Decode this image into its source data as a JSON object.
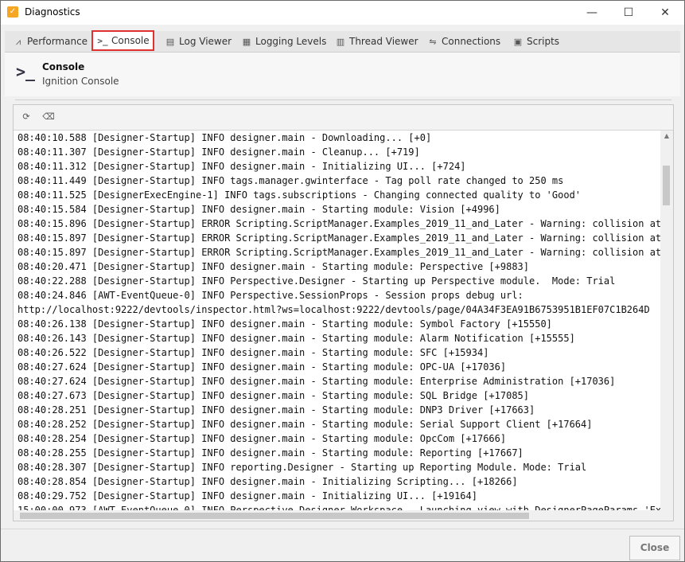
{
  "window": {
    "title": "Diagnostics"
  },
  "tabs": [
    {
      "label": "Performance",
      "icon": "pulse-icon"
    },
    {
      "label": "Console",
      "icon": "terminal-icon",
      "active": true
    },
    {
      "label": "Log Viewer",
      "icon": "document-icon"
    },
    {
      "label": "Logging Levels",
      "icon": "table-icon"
    },
    {
      "label": "Thread Viewer",
      "icon": "thread-icon"
    },
    {
      "label": "Connections",
      "icon": "connection-icon"
    },
    {
      "label": "Scripts",
      "icon": "script-icon"
    }
  ],
  "header": {
    "title": "Console",
    "subtitle": "Ignition Console"
  },
  "colors": {
    "active_tab_outline": "#e03030"
  },
  "log_lines": [
    "08:40:10.588 [Designer-Startup] INFO designer.main - Downloading... [+0]",
    "08:40:11.307 [Designer-Startup] INFO designer.main - Cleanup... [+719]",
    "08:40:11.312 [Designer-Startup] INFO designer.main - Initializing UI... [+724]",
    "08:40:11.449 [Designer-Startup] INFO tags.manager.gwinterface - Tag poll rate changed to 250 ms",
    "08:40:11.525 [DesignerExecEngine-1] INFO tags.subscriptions - Changing connected quality to 'Good'",
    "08:40:15.584 [Designer-Startup] INFO designer.main - Starting module: Vision [+4996]",
    "08:40:15.896 [Designer-Startup] ERROR Scripting.ScriptManager.Examples_2019_11_and_Later - Warning: collision at sys",
    "08:40:15.897 [Designer-Startup] ERROR Scripting.ScriptManager.Examples_2019_11_and_Later - Warning: collision at sys",
    "08:40:15.897 [Designer-Startup] ERROR Scripting.ScriptManager.Examples_2019_11_and_Later - Warning: collision at sys",
    "08:40:20.471 [Designer-Startup] INFO designer.main - Starting module: Perspective [+9883]",
    "08:40:22.288 [Designer-Startup] INFO Perspective.Designer - Starting up Perspective module.  Mode: Trial",
    "08:40:24.846 [AWT-EventQueue-0] INFO Perspective.SessionProps - Session props debug url:",
    "http://localhost:9222/devtools/inspector.html?ws=localhost:9222/devtools/page/04A34F3EA91B6753951B1EF07C1B264D",
    "08:40:26.138 [Designer-Startup] INFO designer.main - Starting module: Symbol Factory [+15550]",
    "08:40:26.143 [Designer-Startup] INFO designer.main - Starting module: Alarm Notification [+15555]",
    "08:40:26.522 [Designer-Startup] INFO designer.main - Starting module: SFC [+15934]",
    "08:40:27.624 [Designer-Startup] INFO designer.main - Starting module: OPC-UA [+17036]",
    "08:40:27.624 [Designer-Startup] INFO designer.main - Starting module: Enterprise Administration [+17036]",
    "08:40:27.673 [Designer-Startup] INFO designer.main - Starting module: SQL Bridge [+17085]",
    "08:40:28.251 [Designer-Startup] INFO designer.main - Starting module: DNP3 Driver [+17663]",
    "08:40:28.252 [Designer-Startup] INFO designer.main - Starting module: Serial Support Client [+17664]",
    "08:40:28.254 [Designer-Startup] INFO designer.main - Starting module: OpcCom [+17666]",
    "08:40:28.255 [Designer-Startup] INFO designer.main - Starting module: Reporting [+17667]",
    "08:40:28.307 [Designer-Startup] INFO reporting.Designer - Starting up Reporting Module. Mode: Trial",
    "08:40:28.854 [Designer-Startup] INFO designer.main - Initializing Scripting... [+18266]",
    "08:40:29.752 [Designer-Startup] INFO designer.main - Initializing UI... [+19164]",
    "15:00:00.973 [AWT-EventQueue-0] INFO Perspective.Designer.Workspace - Launching view with DesignerPageParams 'Examp"
  ],
  "footer": {
    "close_label": "Close"
  }
}
